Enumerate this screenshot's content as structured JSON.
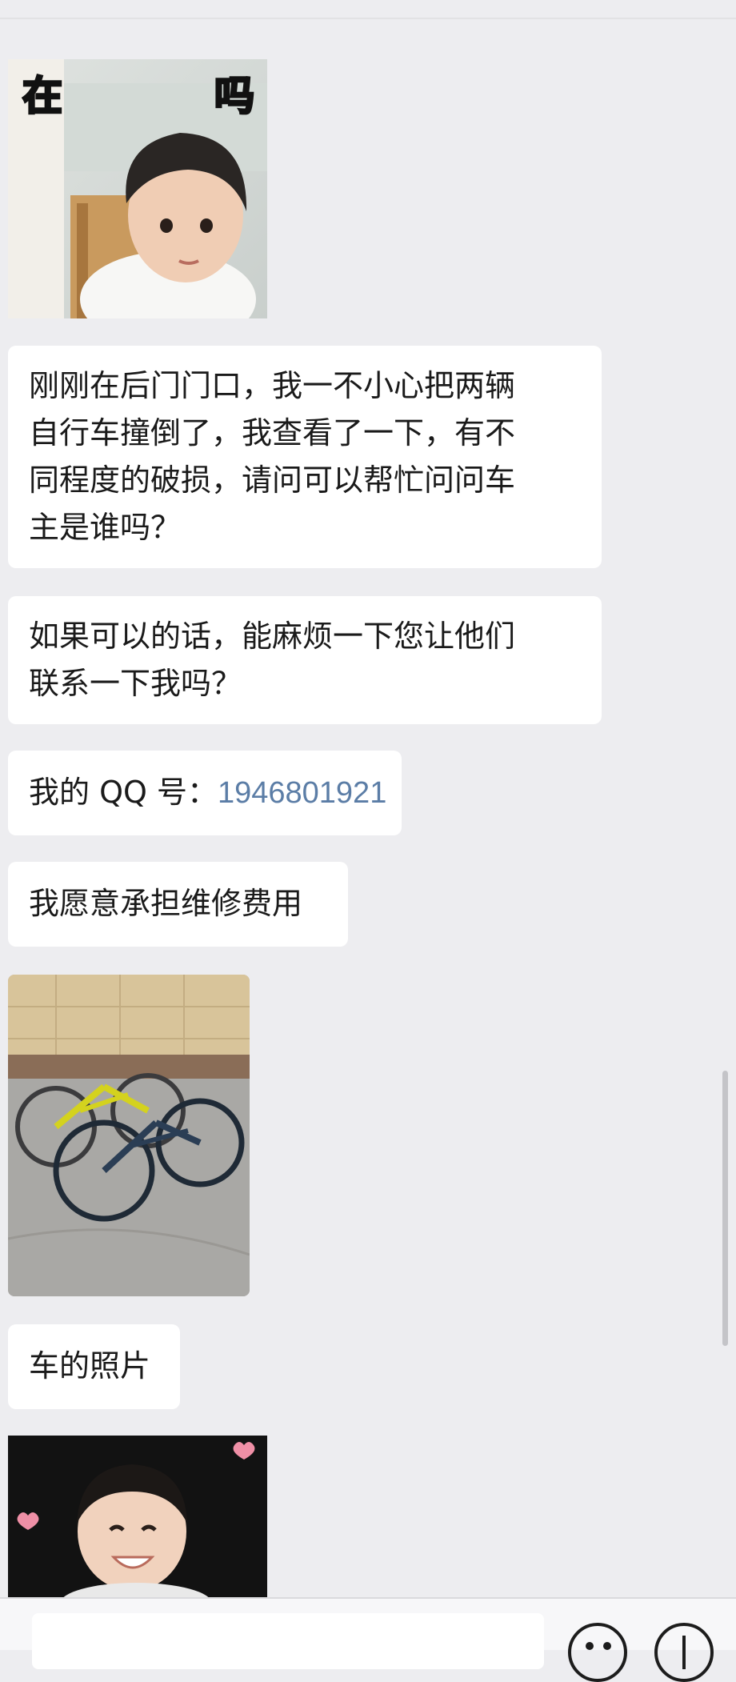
{
  "messages": [
    {
      "kind": "sticker",
      "caption_left": "在",
      "caption_right": "吗"
    },
    {
      "kind": "text",
      "lines": [
        "刚刚在后门门口，我一不小心把两辆",
        "自行车撞倒了，我查看了一下，有不",
        "同程度的破损，请问可以帮忙问问车",
        "主是谁吗？"
      ]
    },
    {
      "kind": "text",
      "lines": [
        "如果可以的话，能麻烦一下您让他们",
        "联系一下我吗？"
      ]
    },
    {
      "kind": "text",
      "prefix": "我的 QQ 号：",
      "link": "1946801921"
    },
    {
      "kind": "text",
      "text": "我愿意承担维修费用"
    },
    {
      "kind": "image",
      "description": "bicycles-photo"
    },
    {
      "kind": "text",
      "text": "车的照片"
    },
    {
      "kind": "sticker",
      "description": "smiling-child-sticker"
    }
  ],
  "colors": {
    "background": "#ededf0",
    "bubble": "#ffffff",
    "link": "#5b7da6",
    "text": "#1a1a1a"
  },
  "input_bar": {
    "icons": [
      "emoji-icon",
      "add-icon"
    ]
  }
}
